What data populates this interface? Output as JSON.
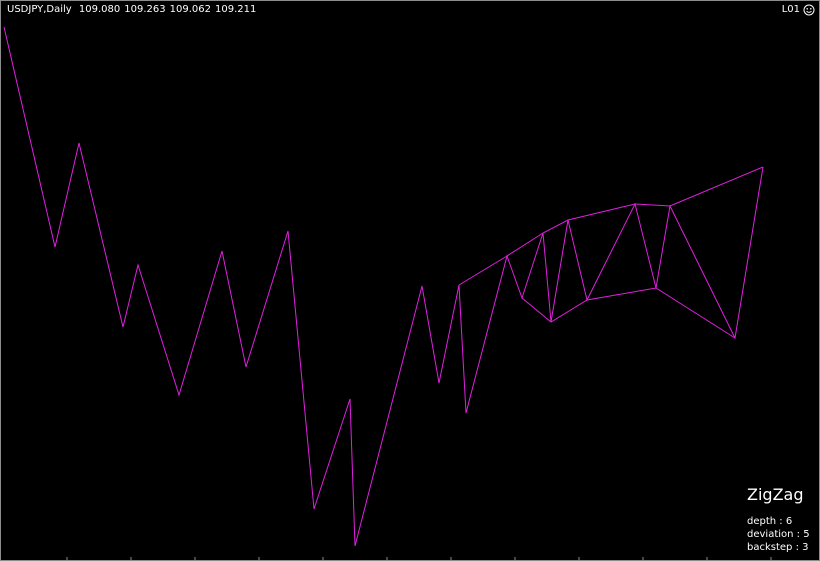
{
  "header": {
    "symbol": "USDJPY,Daily",
    "open": "109.080",
    "high": "109.263",
    "low": "109.062",
    "close": "109.211"
  },
  "top_right": {
    "label": "L01",
    "icon": "smiley-icon"
  },
  "indicator": {
    "name": "ZigZag",
    "params": [
      {
        "key": "depth",
        "value": "6",
        "text": "depth : 6"
      },
      {
        "key": "deviation",
        "value": "5",
        "text": "deviation : 5"
      },
      {
        "key": "backstep",
        "value": "3",
        "text": "backstep : 3"
      }
    ]
  },
  "colors": {
    "background": "#000000",
    "zigzag": "#e020e0",
    "frame": "#8c8c8c",
    "text": "#ffffff"
  }
}
